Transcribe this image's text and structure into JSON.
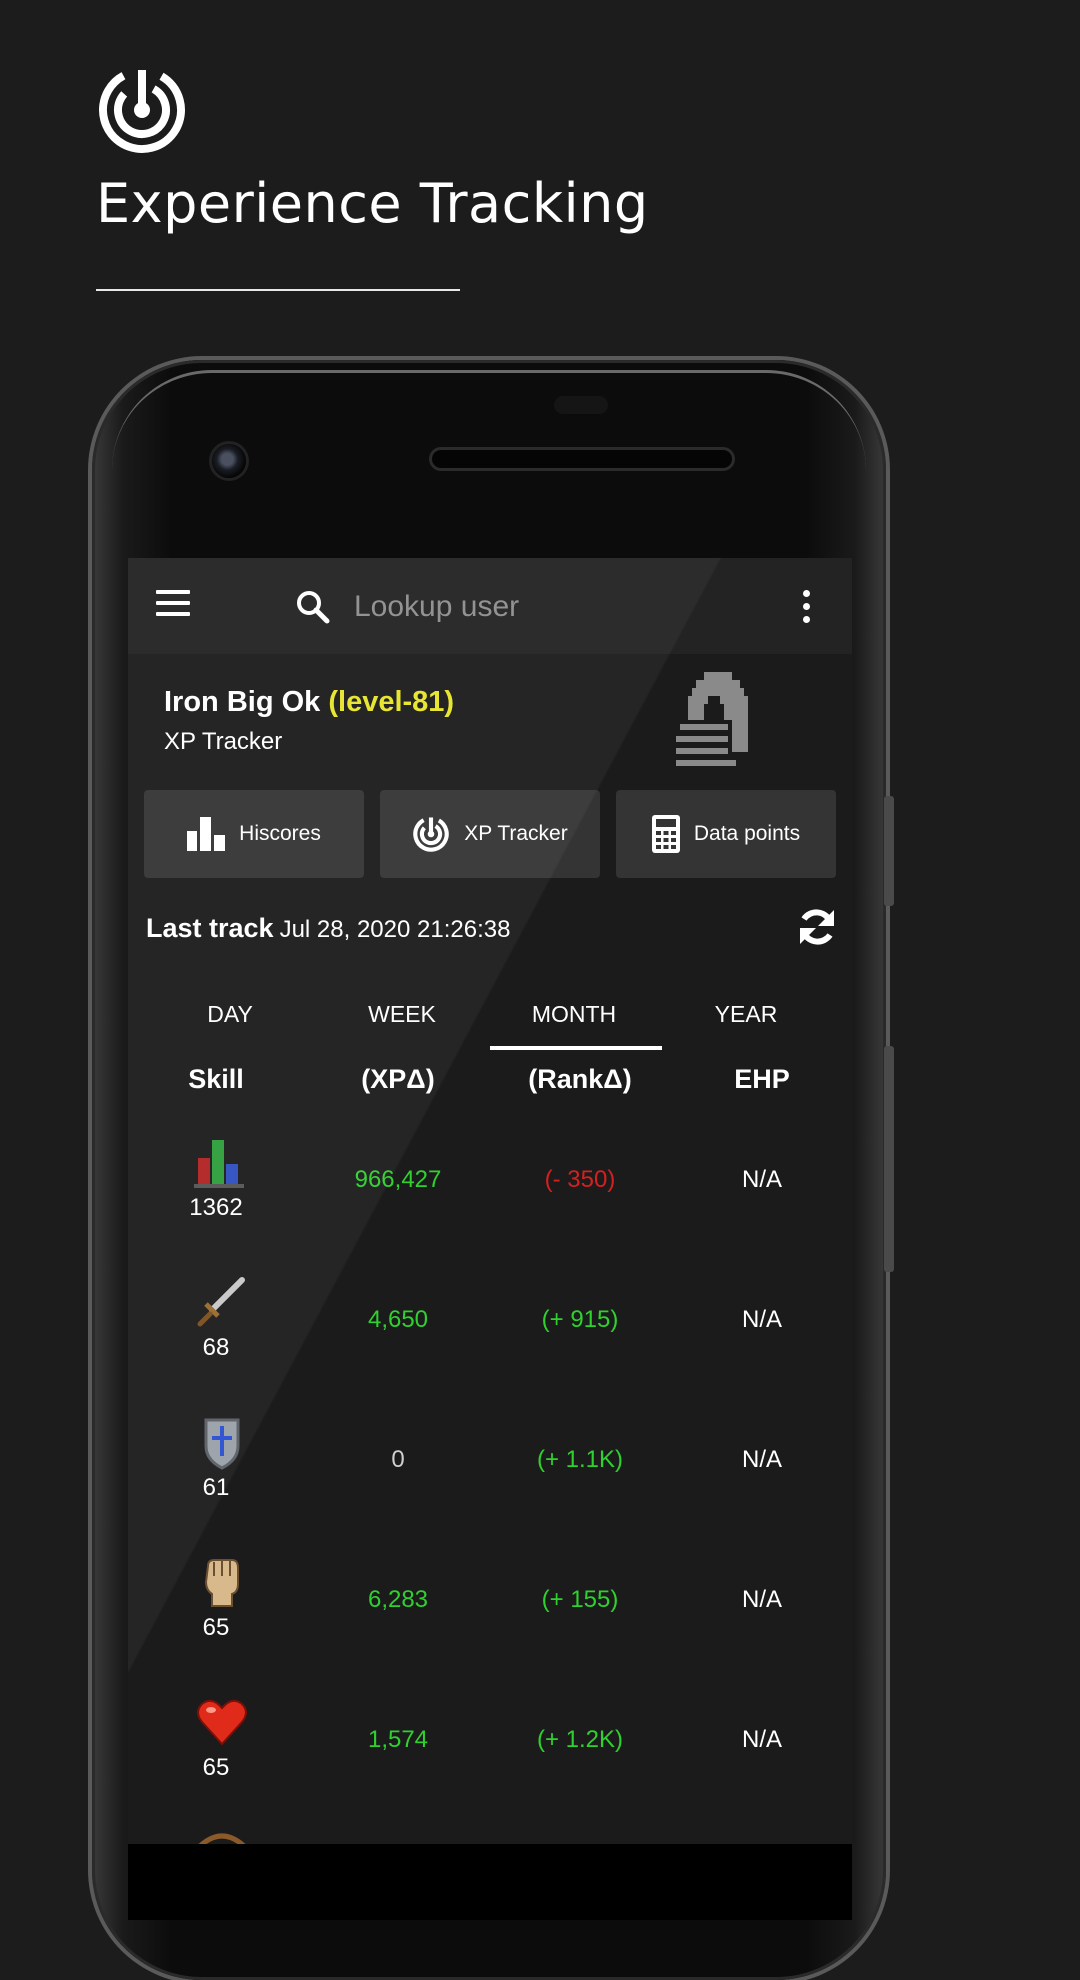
{
  "promo": {
    "title": "Experience Tracking"
  },
  "appbar": {
    "search_placeholder": "Lookup user"
  },
  "user": {
    "name": "Iron Big Ok",
    "level": "(level-81)",
    "subtitle": "XP Tracker"
  },
  "quick_actions": [
    {
      "label": "Hiscores",
      "icon": "bar-chart-icon"
    },
    {
      "label": "XP Tracker",
      "icon": "tracker-icon"
    },
    {
      "label": "Data points",
      "icon": "calculator-icon"
    }
  ],
  "last_track": {
    "label": "Last track",
    "value": "Jul 28, 2020 21:26:38"
  },
  "tabs": [
    "DAY",
    "WEEK",
    "MONTH",
    "YEAR"
  ],
  "selected_tab": "MONTH",
  "columns": [
    "Skill",
    "(XPΔ)",
    "(RankΔ)",
    "EHP"
  ],
  "rows": [
    {
      "skill": "overall",
      "level": "1362",
      "xp": "966,427",
      "rank": "(- 350)",
      "ehp": "N/A"
    },
    {
      "skill": "attack",
      "level": "68",
      "xp": "4,650",
      "rank": "(+ 915)",
      "ehp": "N/A"
    },
    {
      "skill": "defence",
      "level": "61",
      "xp": "0",
      "rank": "(+ 1.1K)",
      "ehp": "N/A"
    },
    {
      "skill": "strength",
      "level": "65",
      "xp": "6,283",
      "rank": "(+ 155)",
      "ehp": "N/A"
    },
    {
      "skill": "hitpoints",
      "level": "65",
      "xp": "1,574",
      "rank": "(+ 1.2K)",
      "ehp": "N/A"
    }
  ],
  "colors": {
    "positive": "#2fd12f",
    "negative": "#d42020",
    "level_highlight": "#e7e42a",
    "button_bg": "#343434"
  }
}
